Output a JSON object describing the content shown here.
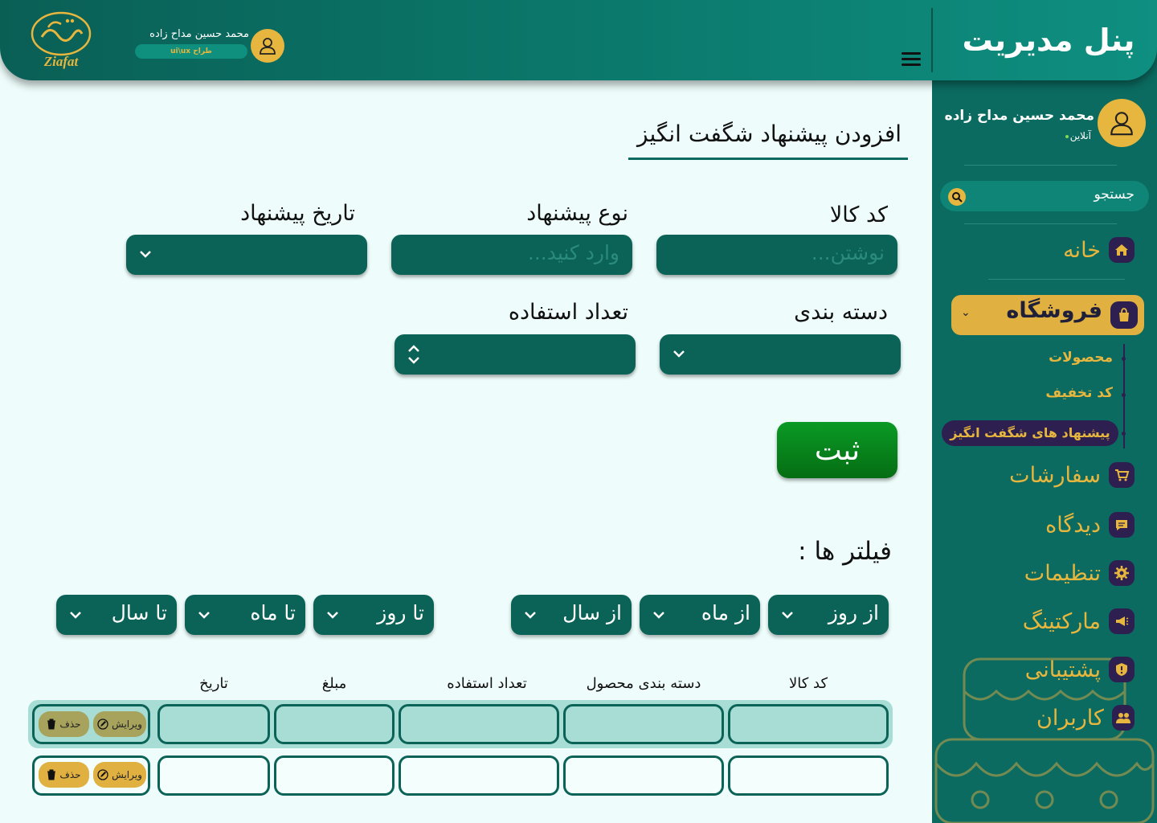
{
  "header": {
    "panel_title": "پنل مدیریت",
    "user_name": "محمد حسین مداح زاده",
    "user_role": "طراح ui\\ux",
    "logo_text": "Ziafat"
  },
  "sidebar": {
    "user_name": "محمد حسین مداح زاده",
    "status": "آنلاین",
    "search_placeholder": "جستجو",
    "nav": {
      "home": "خانه",
      "store": "فروشگاه",
      "store_sub": [
        "محصولات",
        "کد تخفیف",
        "پیشنهاد های شگفت انگیز"
      ],
      "orders": "سفارشات",
      "comments": "دیدگاه",
      "settings": "تنظیمات",
      "marketing": "مارکتینگ",
      "support": "پشتیبانی",
      "users": "کاربران"
    }
  },
  "form": {
    "title": "افزودن پیشنهاد شگفت انگیز",
    "product_code_label": "کد کالا",
    "product_code_placeholder": "نوشتن...",
    "offer_type_label": "نوع  پیشنهاد",
    "offer_type_placeholder": "وارد کنید...",
    "offer_date_label": "تاریخ پیشنهاد",
    "category_label": "دسته بندی",
    "usage_count_label": "تعداد استفاده",
    "submit_label": "ثبت"
  },
  "filters": {
    "title": "فیلتر ها :",
    "from_day": "از روز",
    "from_month": "از ماه",
    "from_year": "از سال",
    "to_day": "تا روز",
    "to_month": "تا ماه",
    "to_year": "تا سال"
  },
  "table": {
    "columns": [
      "کد کالا",
      "دسته بندی محصول",
      "تعداد استفاده",
      "مبلغ",
      "تاریخ"
    ],
    "edit_label": "ویرایش",
    "delete_label": "حذف"
  },
  "colors": {
    "primary": "#0b6b60",
    "accent": "#e7b63e",
    "submit": "#078a1c",
    "dark_purple": "#2d1f4f",
    "row_highlight": "#a8ddd6"
  }
}
